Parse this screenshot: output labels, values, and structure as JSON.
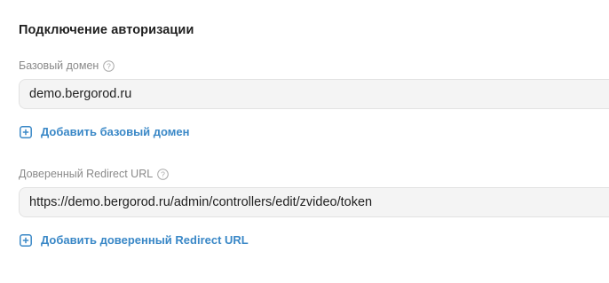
{
  "section": {
    "title": "Подключение авторизации"
  },
  "base_domain": {
    "label": "Базовый домен",
    "value": "demo.bergorod.ru",
    "add_label": "Добавить базовый домен"
  },
  "redirect_url": {
    "label": "Доверенный Redirect URL",
    "value": "https://demo.bergorod.ru/admin/controllers/edit/zvideo/token",
    "add_label": "Добавить доверенный Redirect URL"
  },
  "icons": {
    "help": "question-circle-icon",
    "add": "plus-square-icon"
  },
  "colors": {
    "link": "#3a88c7",
    "label": "#8a8a8a",
    "input_bg": "#f4f4f4"
  }
}
